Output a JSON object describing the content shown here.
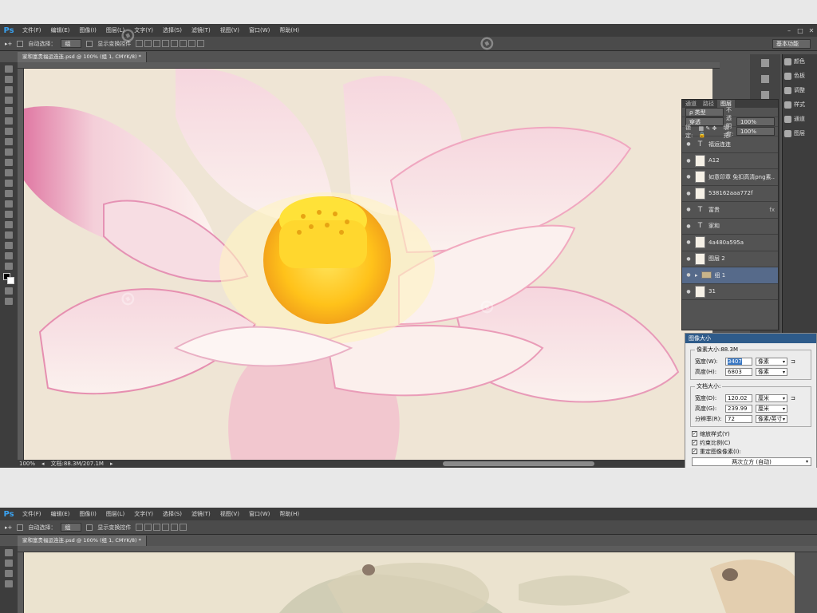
{
  "app": {
    "logo": "Ps"
  },
  "menu": [
    "文件(F)",
    "编辑(E)",
    "图像(I)",
    "图层(L)",
    "文字(Y)",
    "选择(S)",
    "滤镜(T)",
    "视图(V)",
    "窗口(W)",
    "帮助(H)"
  ],
  "options": {
    "auto_select_label": "自动选择：",
    "auto_select_value": "组",
    "show_transform_label": "显示变换控件",
    "workspace": "基本功能"
  },
  "document": {
    "tab_title": "家和富贵福运连连.psd @ 100% (组 1, CMYK/8) *",
    "zoom": "100%",
    "doc_info": "文档:88.3M/207.1M"
  },
  "right_dock": {
    "items": [
      "颜色",
      "色板",
      "调整",
      "样式",
      "通道",
      "图层"
    ]
  },
  "layers_panel": {
    "tabs": [
      "通道",
      "路径",
      "图层"
    ],
    "kind_label": "ρ 类型",
    "blend_mode": "穿透",
    "opacity_label": "不透明度:",
    "opacity_value": "100%",
    "lock_label": "锁定:",
    "fill_label": "填充:",
    "fill_value": "100%",
    "layers": [
      {
        "name": "福运连连",
        "type": "text",
        "fx": false,
        "selected": false
      },
      {
        "name": "A12",
        "type": "image",
        "fx": false,
        "selected": false
      },
      {
        "name": "如意印章 免扣高清png素...",
        "type": "image",
        "fx": false,
        "selected": false
      },
      {
        "name": "538162aaa772f",
        "type": "image",
        "fx": false,
        "selected": false
      },
      {
        "name": "富贵",
        "type": "text",
        "fx": true,
        "selected": false
      },
      {
        "name": "家和",
        "type": "text",
        "fx": false,
        "selected": false
      },
      {
        "name": "4a480a595a",
        "type": "image",
        "fx": false,
        "selected": false
      },
      {
        "name": "图层 2",
        "type": "image",
        "fx": false,
        "selected": false
      },
      {
        "name": "组 1",
        "type": "group",
        "fx": false,
        "selected": true
      },
      {
        "name": "31",
        "type": "image",
        "fx": false,
        "selected": false
      }
    ]
  },
  "image_size_dialog": {
    "title": "图像大小",
    "pixel_dimensions_label": "像素大小:88.3M",
    "width_label": "宽度(W):",
    "width_value": "3407",
    "width_unit": "像素",
    "height_label": "高度(H):",
    "height_value": "6803",
    "height_unit": "像素",
    "doc_size_label": "文档大小:",
    "doc_width_label": "宽度(D):",
    "doc_width_value": "120.02",
    "doc_width_unit": "厘米",
    "doc_height_label": "高度(G):",
    "doc_height_value": "239.99",
    "doc_height_unit": "厘米",
    "resolution_label": "分辨率(R):",
    "resolution_value": "72",
    "resolution_unit": "像素/英寸",
    "scale_styles": "缩放样式(Y)",
    "constrain": "约束比例(C)",
    "resample": "重定图像像素(I):",
    "interpolation": "两次立方 (自动)"
  }
}
